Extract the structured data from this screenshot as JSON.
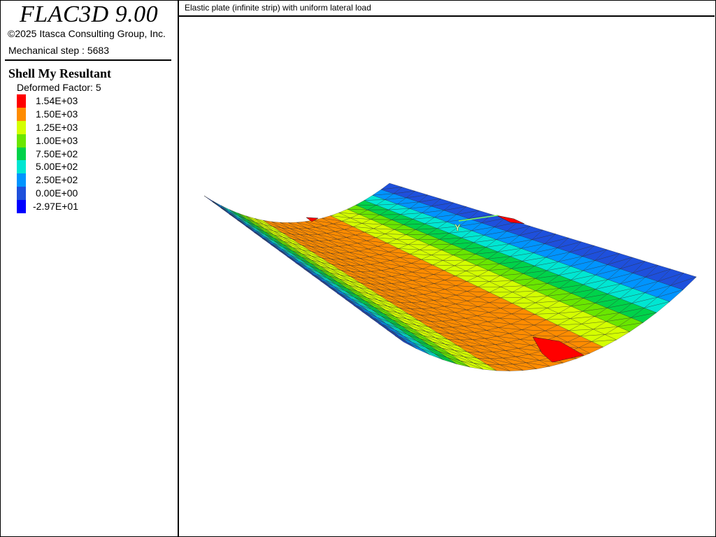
{
  "app": {
    "title": "FLAC3D 9.00",
    "copyright": "©2025 Itasca Consulting Group, Inc.",
    "step": "Mechanical step : 5683"
  },
  "plot": {
    "title": "Shell My Resultant",
    "deformed": "Deformed Factor: 5",
    "legend": [
      {
        "label": "1.54E+03",
        "color": "#ff0000"
      },
      {
        "label": "1.50E+03",
        "color": "#ff8c00"
      },
      {
        "label": "1.25E+03",
        "color": "#d4ff00"
      },
      {
        "label": "1.00E+03",
        "color": "#6ae600"
      },
      {
        "label": "7.50E+02",
        "color": "#00d24a"
      },
      {
        "label": "5.00E+02",
        "color": "#00e6d2"
      },
      {
        "label": "2.50E+02",
        "color": "#0094ff"
      },
      {
        "label": "0.00E+00",
        "color": "#1e50dc"
      },
      {
        "label": "-2.97E+01",
        "color": "#0000ff"
      }
    ]
  },
  "view": {
    "model_title": "Elastic plate (infinite strip) with uniform lateral load",
    "axis_label": "Y"
  }
}
